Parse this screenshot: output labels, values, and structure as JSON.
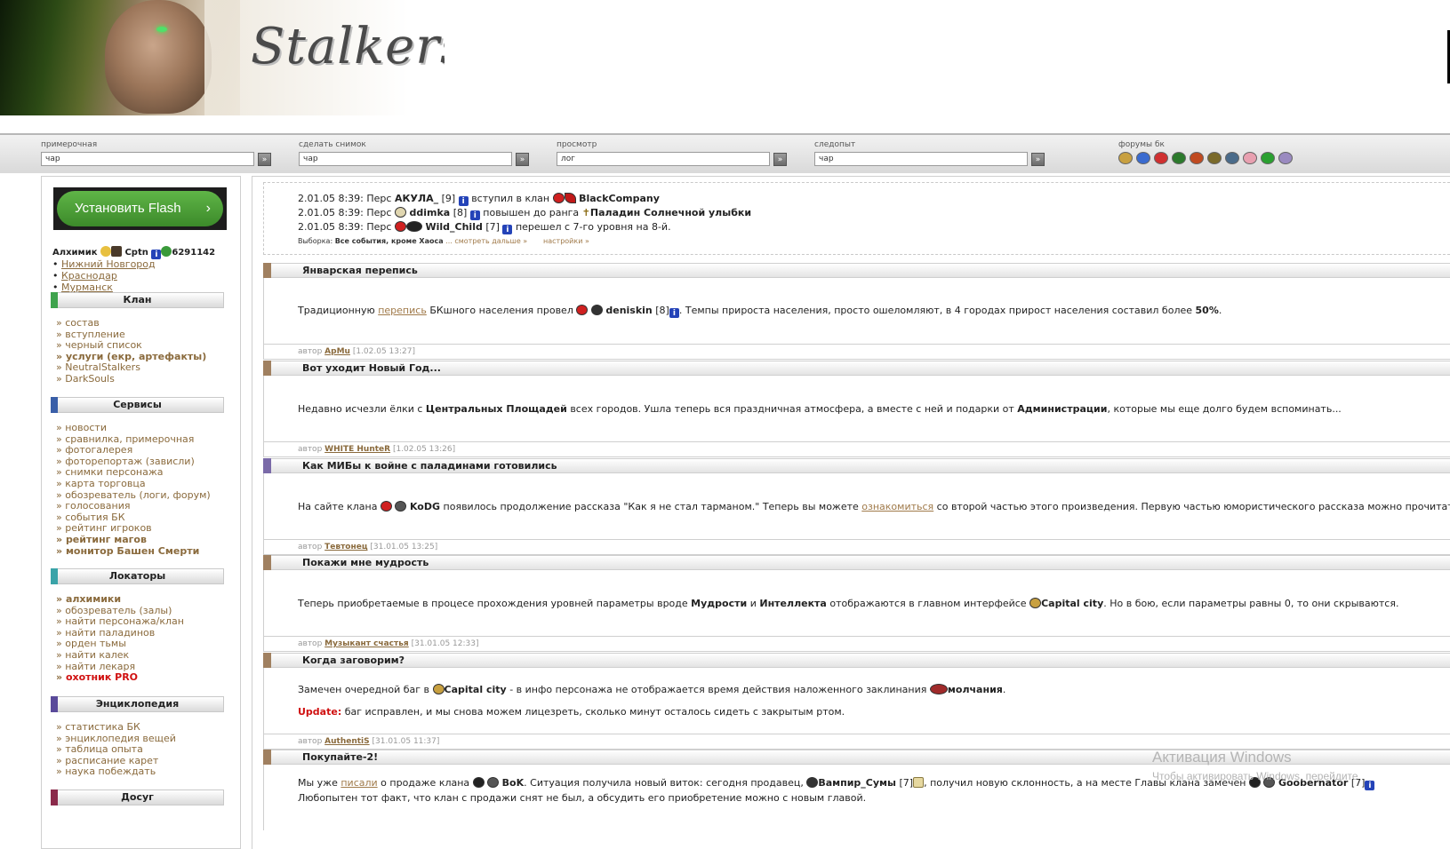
{
  "banner": {
    "logo": "Stalkers"
  },
  "search": [
    {
      "label": "примерочная",
      "value": "чар"
    },
    {
      "label": "сделать снимок",
      "value": "чар"
    },
    {
      "label": "просмотр",
      "value": "лог"
    },
    {
      "label": "следопыт",
      "value": "чар"
    }
  ],
  "forums": {
    "label": "форумы бк",
    "icon_colors": [
      "#c8a040",
      "#3a6bd0",
      "#d03030",
      "#2c7a2c",
      "#c04a20",
      "#7a6a2a",
      "#4a6b8a",
      "#e8a0b0",
      "#2aa030",
      "#9a8ac0"
    ]
  },
  "sidebar": {
    "flash_button": "Установить Flash",
    "user": {
      "prefix": "Алхимик",
      "rank": "Cptn",
      "number": "6291142"
    },
    "cities": [
      "Нижний Новгород",
      "Краснодар",
      "Мурманск"
    ],
    "sections": [
      {
        "title": "Клан",
        "color": "#3fa34d",
        "items": [
          {
            "label": "состав",
            "style": ""
          },
          {
            "label": "вступление",
            "style": ""
          },
          {
            "label": "черный список",
            "style": ""
          },
          {
            "label": "услуги (екр, артефакты)",
            "style": "b"
          },
          {
            "label": "NeutralStalkers",
            "style": ""
          },
          {
            "label": "DarkSouls",
            "style": ""
          }
        ]
      },
      {
        "title": "Сервисы",
        "color": "#3a5fa8",
        "items": [
          {
            "label": "новости",
            "style": ""
          },
          {
            "label": "сравнилка, примерочная",
            "style": ""
          },
          {
            "label": "фотогалерея",
            "style": ""
          },
          {
            "label": "фоторепортаж (зависли)",
            "style": ""
          },
          {
            "label": "снимки персонажа",
            "style": ""
          },
          {
            "label": "карта торговца",
            "style": ""
          },
          {
            "label": "обозреватель (логи, форум)",
            "style": ""
          },
          {
            "label": "голосования",
            "style": ""
          },
          {
            "label": "события БК",
            "style": ""
          },
          {
            "label": "рейтинг игроков",
            "style": ""
          },
          {
            "label": "рейтинг магов",
            "style": "b"
          },
          {
            "label": "монитор Башен Смерти",
            "style": "b"
          }
        ]
      },
      {
        "title": "Локаторы",
        "color": "#3aa3a8",
        "items": [
          {
            "label": "алхимики",
            "style": "b"
          },
          {
            "label": "обозреватель (залы)",
            "style": ""
          },
          {
            "label": "найти персонажа/клан",
            "style": ""
          },
          {
            "label": "найти паладинов",
            "style": ""
          },
          {
            "label": "орден тьмы",
            "style": ""
          },
          {
            "label": "найти калек",
            "style": ""
          },
          {
            "label": "найти лекаря",
            "style": ""
          },
          {
            "label": "охотник PRO",
            "style": "red"
          }
        ]
      },
      {
        "title": "Энциклопедия",
        "color": "#5a4a9a",
        "items": [
          {
            "label": "статистика БК",
            "style": ""
          },
          {
            "label": "энциклопедия вещей",
            "style": ""
          },
          {
            "label": "таблица опыта",
            "style": ""
          },
          {
            "label": "расписание карет",
            "style": ""
          },
          {
            "label": "наука побеждать",
            "style": ""
          }
        ]
      },
      {
        "title": "Досуг",
        "color": "#8a2a4a",
        "items": []
      }
    ]
  },
  "events": {
    "lines": [
      {
        "time": "2.01.05 8:39:",
        "pre": "Перс",
        "name": "АКУЛА_",
        "level": "[9]",
        "action": "вступил в клан",
        "target": "BlackCompany"
      },
      {
        "time": "2.01.05 8:39:",
        "pre": "Перс",
        "name": "ddimka",
        "level": "[8]",
        "action": "повышен до ранга",
        "target": "Паладин Солнечной улыбки"
      },
      {
        "time": "2.01.05 8:39:",
        "pre": "Перс",
        "name": "Wild_Child",
        "level": "[7]",
        "action": "перешел с 7-го уровня на 8-й.",
        "target": ""
      }
    ],
    "selection_label": "Выборка:",
    "selection_value": "Все события, кроме Хаоса",
    "more": "... смотреть дальше »",
    "settings": "настройки »"
  },
  "news": [
    {
      "title": "Январская перепись",
      "color": "#a08060",
      "author_label": "автор",
      "author": "ApMu",
      "date": "[1.02.05 13:27]"
    },
    {
      "title": "Вот уходит Новый Год...",
      "color": "#a08060",
      "author_label": "автор",
      "author": "WHITE HunteR",
      "date": "[1.02.05 13:26]"
    },
    {
      "title": "Как МИБы к войне с паладинами готовились",
      "color": "#7a6aa8",
      "author_label": "автор",
      "author": "Тевтонец",
      "date": "[31.01.05 13:25]"
    },
    {
      "title": "Покажи мне мудрость",
      "color": "#a08060",
      "author_label": "автор",
      "author": "Музыкант счастья",
      "date": "[31.01.05 12:33]"
    },
    {
      "title": "Когда заговорим?",
      "color": "#a08060",
      "author_label": "автор",
      "author": "AuthentiS",
      "date": "[31.01.05 11:37]"
    },
    {
      "title": "Покупайте-2!",
      "color": "#a08060",
      "author_label": "",
      "author": "",
      "date": ""
    }
  ],
  "news_text": {
    "n0": {
      "a": "Традиционную",
      "link": "перепись",
      "b": "БКшного населения провел",
      "name": "deniskin",
      "lvl": "[8]",
      "c": ". Темпы прироста населения, просто ошеломляют, в 4 городах прирост населения составил более",
      "pct": "50%",
      "d": "."
    },
    "n1": {
      "a": "Недавно исчезли ёлки с",
      "b1": "Центральных Площадей",
      "a2": "всех городов. Ушла теперь вся праздничная атмосфера, а вместе с ней и подарки от",
      "b2": "Администрации",
      "a3": ", которые мы еще долго будем вспоминать..."
    },
    "n2": {
      "a": "На сайте клана",
      "name": "KoDG",
      "b": "появилось продолжение рассказа \"Как я не стал тарманом.\" Теперь вы можете",
      "link": "ознакомиться",
      "c": "со второй частью этого произведения. Первую частью юмористического рассказа можно прочитать"
    },
    "n3": {
      "a": "Теперь приобретаемые в процесе прохождения уровней параметры вроде",
      "b1": "Мудрости",
      "and": "и",
      "b2": "Интеллекта",
      "a2": "отображаются в главном интерфейсе",
      "city": "Capital city",
      "a3": ". Но в бою, если параметры равны 0, то они скрываются."
    },
    "n4": {
      "a": "Замечен очередной баг в",
      "city": "Capital city",
      "b": "- в инфо персонажа не отображается время действия наложенного заклинания",
      "spell": "молчания",
      "c": ".",
      "upd": "Update:",
      "d": "баг исправлен, и мы снова можем лицезреть, сколько минут осталось сидеть с закрытым ртом."
    },
    "n5": {
      "a": "Мы уже",
      "link": "писали",
      "b": "о продаже клана",
      "clan": "BoK",
      "c": ". Ситуация получила новый виток: сегодня продавец,",
      "seller": "Вампир_Сумы",
      "slvl": "[7]",
      "d": ", получил новую склонность, а на месте Главы клана замечен",
      "head": "Goobernator",
      "hlvl": "[7]",
      "line2": "Любопытен тот факт, что клан с продажи снят не был, а обсудить его приобретение можно с новым главой."
    }
  },
  "watermark": {
    "line1": "Активация Windows",
    "line2": "Чтобы активировать Windows, перейдите"
  }
}
